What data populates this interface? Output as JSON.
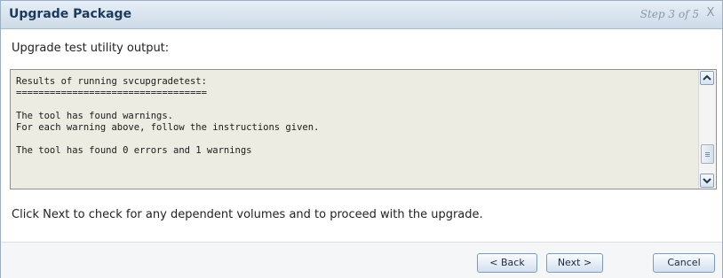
{
  "dialog": {
    "title": "Upgrade Package",
    "step": "Step 3 of 5",
    "close_glyph": "X"
  },
  "output": {
    "label": "Upgrade test utility output:",
    "lines": [
      "Results of running svcupgradetest:",
      "==================================",
      "",
      "The tool has found warnings.",
      "For each warning above, follow the instructions given.",
      "",
      "The tool has found 0 errors and 1 warnings"
    ],
    "scroll_up_glyph": "^",
    "scroll_down_glyph": "v"
  },
  "instruction": "Click Next to check for any dependent volumes and to proceed with the upgrade.",
  "buttons": {
    "back": "< Back",
    "next": "Next >",
    "cancel": "Cancel"
  }
}
